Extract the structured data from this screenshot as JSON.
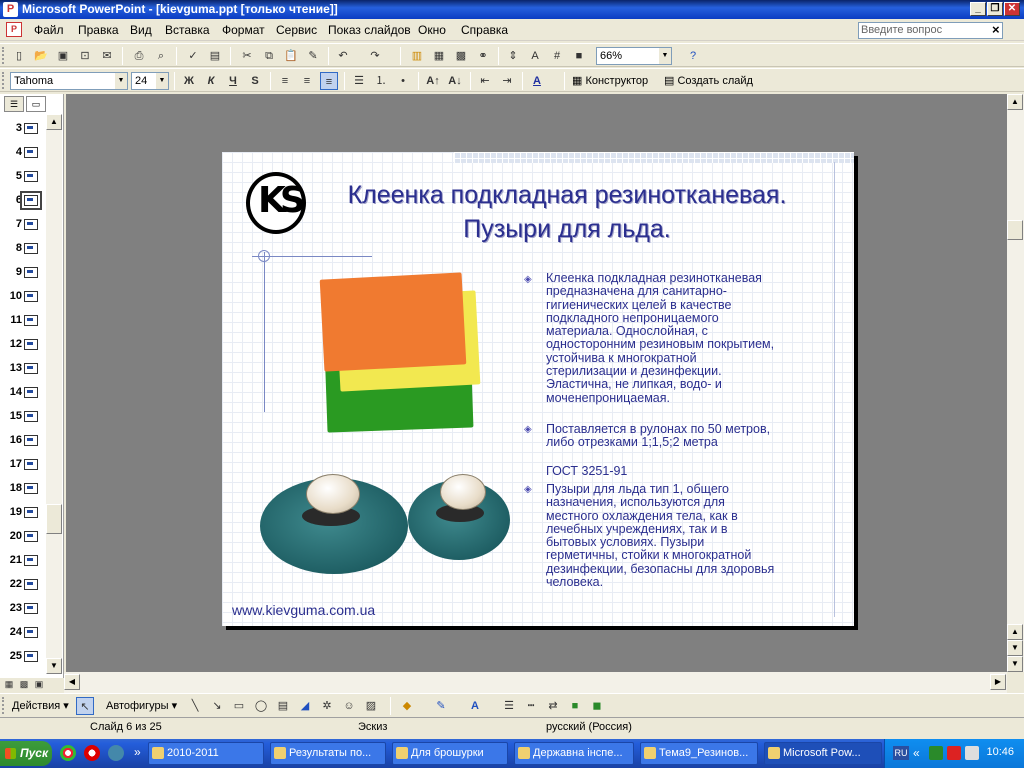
{
  "window": {
    "title": "Microsoft PowerPoint - [kievguma.ppt [только чтение]]",
    "min_label": "_",
    "restore_label": "❐",
    "close_label": "✕"
  },
  "menu": {
    "items": [
      "Файл",
      "Правка",
      "Вид",
      "Вставка",
      "Формат",
      "Сервис",
      "Показ слайдов",
      "Окно",
      "Справка"
    ],
    "ask_placeholder": "Введите вопрос",
    "close_doc": "×"
  },
  "standard_toolbar": {
    "zoom": "66%"
  },
  "format_toolbar": {
    "font": "Tahoma",
    "size": "24",
    "bold": "Ж",
    "italic": "К",
    "underline": "Ч",
    "shadow": "S",
    "designer": "Конструктор",
    "new_slide": "Создать слайд"
  },
  "slide_panel": {
    "numbers": [
      "3",
      "4",
      "5",
      "6",
      "7",
      "8",
      "9",
      "10",
      "11",
      "12",
      "13",
      "14",
      "15",
      "16",
      "17",
      "18",
      "19",
      "20",
      "21",
      "22",
      "23",
      "24",
      "25"
    ],
    "selected": "6"
  },
  "slide": {
    "logo_text": "KS",
    "title_line1": "Клеенка подкладная резинотканевая.",
    "title_line2": "Пузыри для льда.",
    "bullet1": "Клеенка подкладная резинотканевая предназначена для санитарно-гигиенических целей в качестве подкладного непроницаемого материала. Однослойная, с односторонним резиновым покрытием, устойчива к многократной стерилизации и дезинфекции. Эластична, не липкая, водо- и моченепроницаемая.",
    "bullet2": "Поставляется в рулонах по 50 метров, либо отрезками 1;1,5;2 метра",
    "gost": "ГОСТ 3251-91",
    "bullet3": "Пузыри для льда тип 1, общего назначения, используются для местного охлаждения тела, как в лечебных учреждениях, так и в бытовых условиях. Пузыри герметичны, стойки к многократной дезинфекции, безопасны для здоровья человека.",
    "url": "www.kievguma.com.ua",
    "colors": {
      "title": "#2b2f8f",
      "orange_sheet": "#f07a30",
      "yellow_sheet": "#f2e850",
      "green_sheet": "#2a9a22",
      "bag": "#2b6f73"
    }
  },
  "draw_toolbar": {
    "actions": "Действия",
    "autoshapes": "Автофигуры"
  },
  "status": {
    "slide": "Слайд 6 из 25",
    "design": "Эскиз",
    "lang": "русский (Россия)"
  },
  "taskbar": {
    "start": "Пуск",
    "tasks": [
      "2010-2011",
      "Результаты по...",
      "Для брошурки",
      "Державна інспе...",
      "Тема9_Резинов...",
      "Microsoft Pow..."
    ],
    "lang": "RU",
    "clock": "10:46",
    "more": "»",
    "tray_more": "«"
  }
}
